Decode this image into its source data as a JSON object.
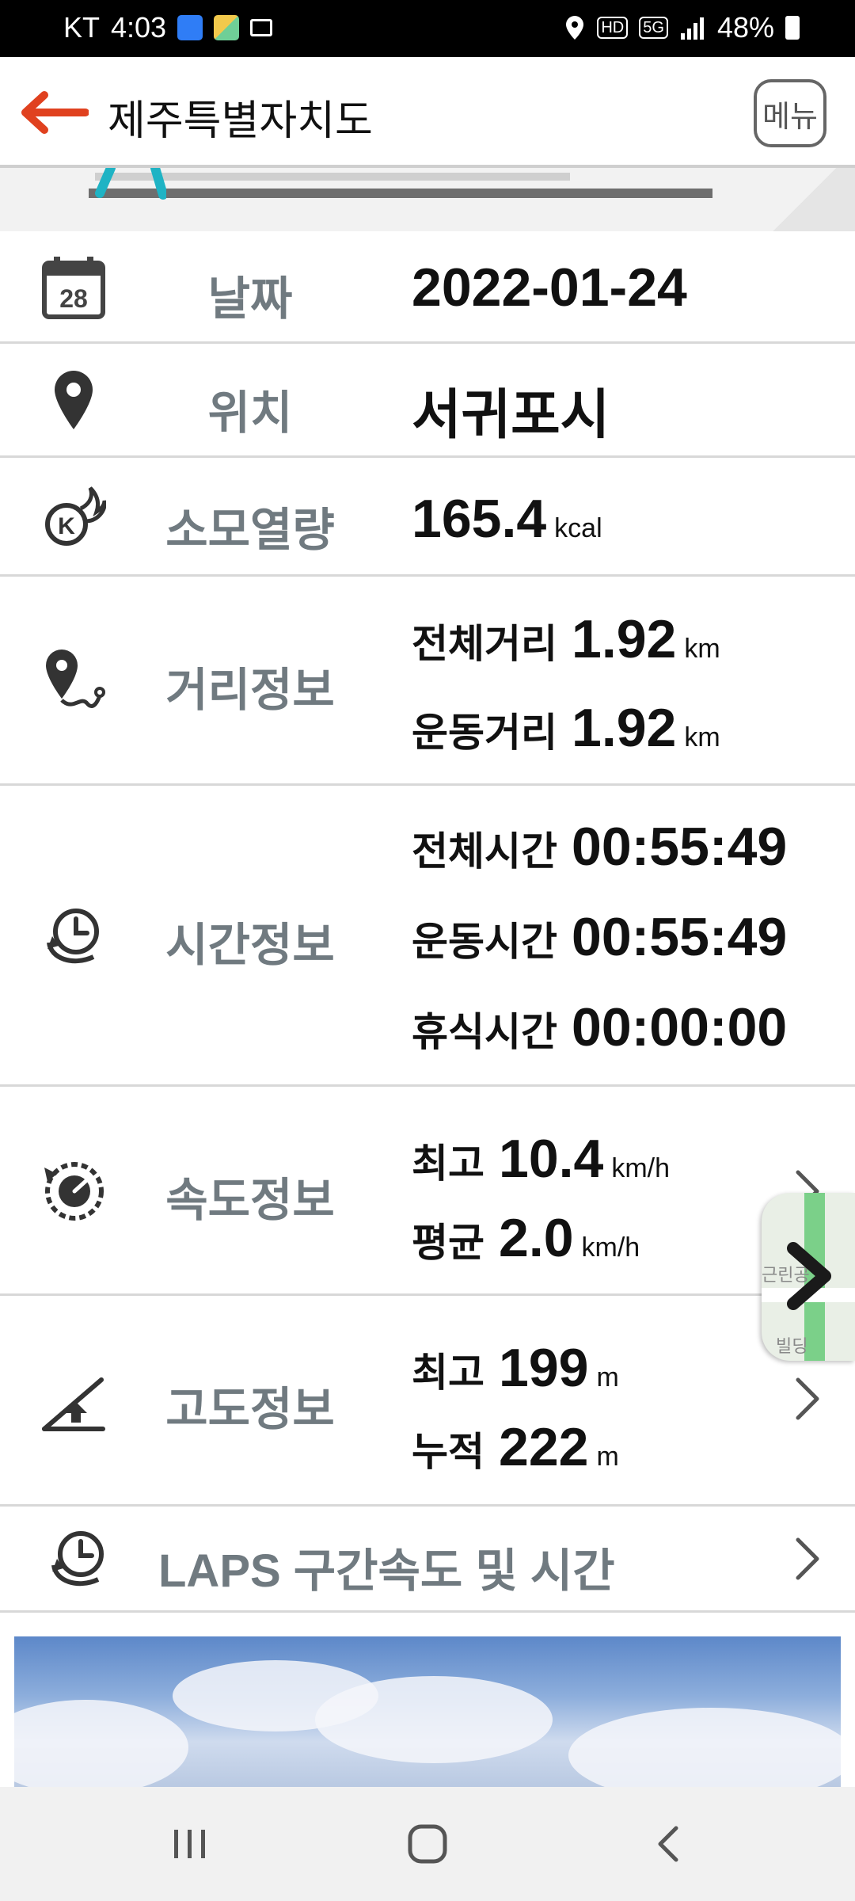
{
  "status_bar": {
    "carrier": "KT",
    "time": "4:03",
    "network_hd": "HD",
    "network_5g": "5G",
    "battery": "48%"
  },
  "header": {
    "title": "제주특별자치도",
    "menu_label": "메뉴"
  },
  "date_row": {
    "label": "날짜",
    "value": "2022-01-24",
    "calendar_day": "28"
  },
  "location_row": {
    "label": "위치",
    "value": "서귀포시"
  },
  "calorie_row": {
    "label": "소모열량",
    "value": "165.4",
    "unit": "kcal"
  },
  "distance_row": {
    "label": "거리정보",
    "items": [
      {
        "key": "전체거리",
        "value": "1.92",
        "unit": "km"
      },
      {
        "key": "운동거리",
        "value": "1.92",
        "unit": "km"
      }
    ]
  },
  "time_row": {
    "label": "시간정보",
    "items": [
      {
        "key": "전체시간",
        "value": "00:55:49"
      },
      {
        "key": "운동시간",
        "value": "00:55:49"
      },
      {
        "key": "휴식시간",
        "value": "00:00:00"
      }
    ]
  },
  "speed_row": {
    "label": "속도정보",
    "items": [
      {
        "key": "최고",
        "value": "10.4",
        "unit": "km/h"
      },
      {
        "key": "평균",
        "value": "2.0",
        "unit": "km/h"
      }
    ]
  },
  "altitude_row": {
    "label": "고도정보",
    "items": [
      {
        "key": "최고",
        "value": "199",
        "unit": "m"
      },
      {
        "key": "누적",
        "value": "222",
        "unit": "m"
      }
    ]
  },
  "laps_row": {
    "label": "LAPS 구간속도 및 시간"
  },
  "map_pill": {
    "text_top": "근린공",
    "text_bottom": "빌딩"
  },
  "colors": {
    "accent": "#e0411f",
    "label_gray": "#707a80",
    "divider": "#d8d8d8"
  }
}
